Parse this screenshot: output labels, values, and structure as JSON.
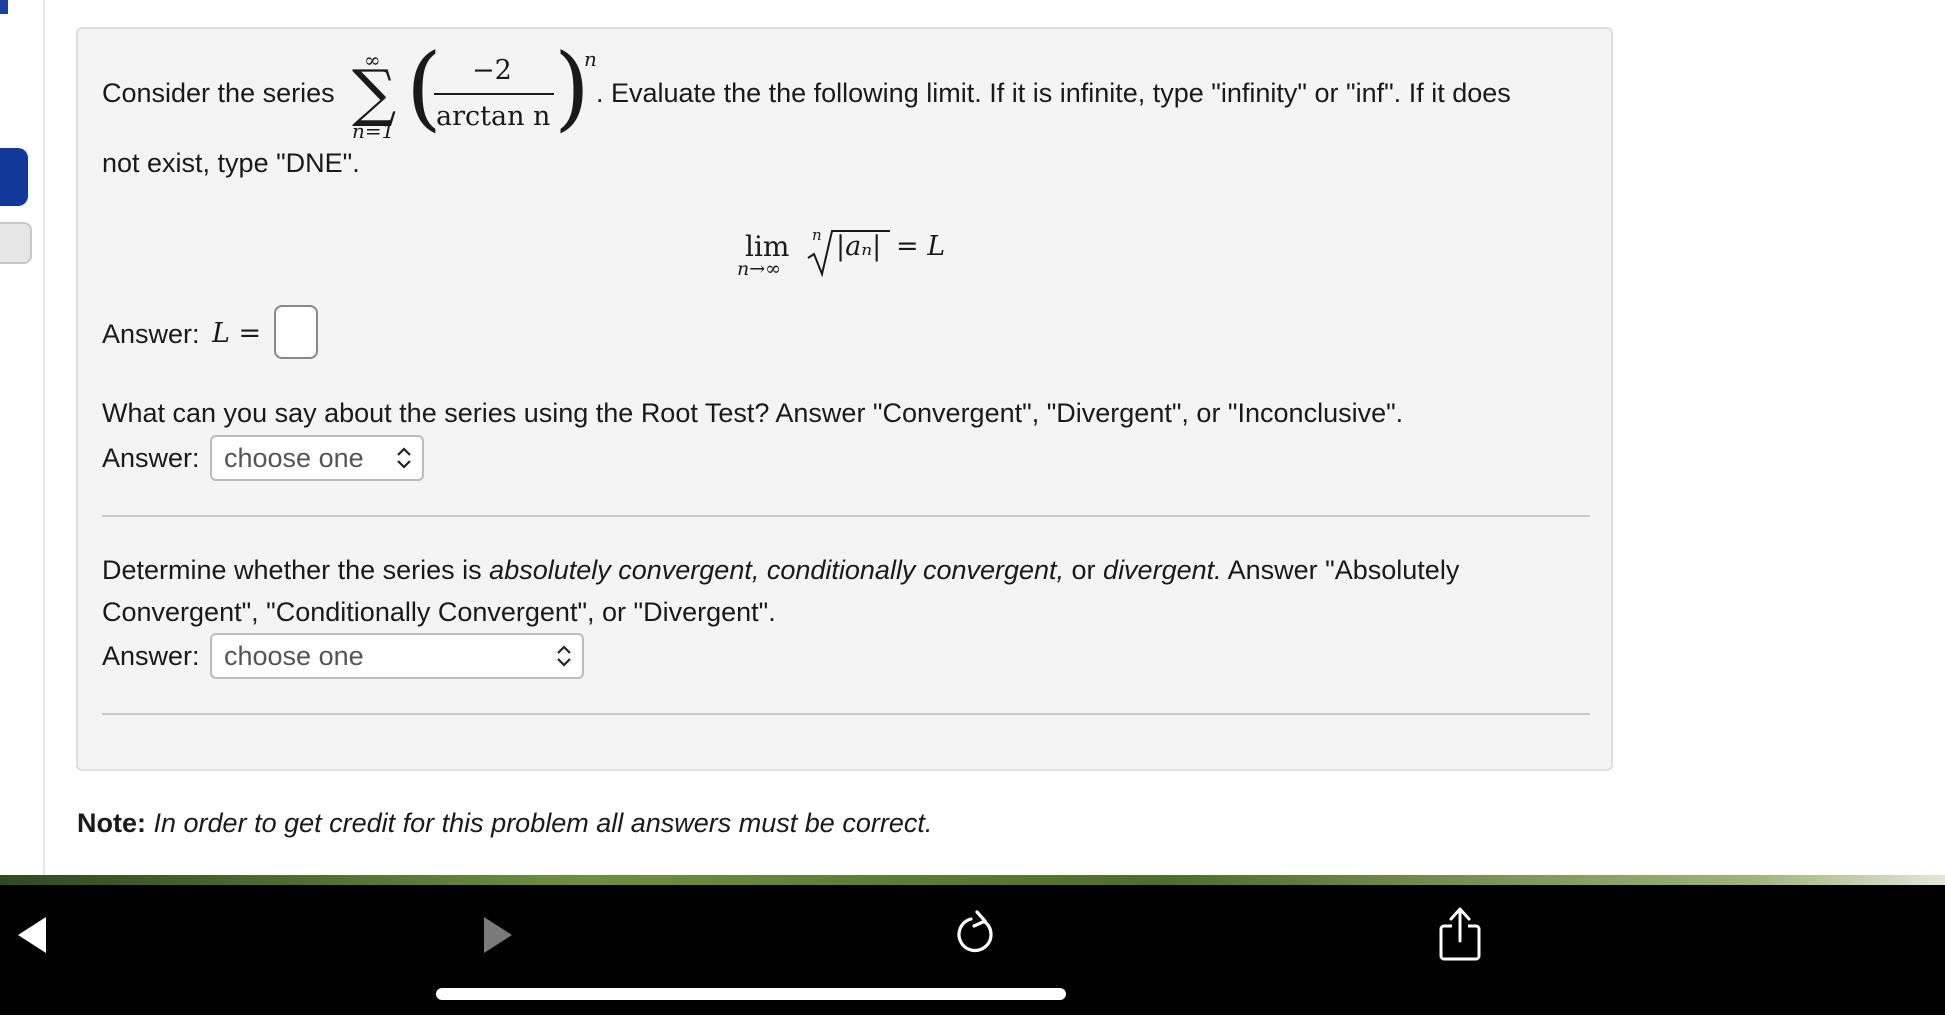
{
  "problem": {
    "intro_before": "Consider the series",
    "series": {
      "upper": "∞",
      "lower": "n=1",
      "numerator": "−2",
      "denominator": "arctan n",
      "exponent": "n"
    },
    "intro_after": ". Evaluate the the following limit. If it is infinite, type \"infinity\" or \"inf\". If it does",
    "intro_line2": "not exist, type \"DNE\".",
    "limit": {
      "lim": "lim",
      "sub": "n→∞",
      "root_index": "n",
      "radicand": "|aₙ|",
      "rhs": "= L"
    },
    "answer_label": "Answer:",
    "answer_var": "L =",
    "root_test_question": "What can you say about the series using the Root Test? Answer \"Convergent\", \"Divergent\", or \"Inconclusive\".",
    "root_test_select": "choose one",
    "determine": {
      "pre": "Determine whether the series is ",
      "italic1": "absolutely convergent, conditionally convergent,",
      "mid": " or ",
      "italic2": "divergent.",
      "post": " Answer \"Absolutely",
      "line2": "Convergent\", \"Conditionally Convergent\", or \"Divergent\"."
    },
    "determine_select": "choose one"
  },
  "note": {
    "label": "Note:",
    "text": "In order to get credit for this problem all answers must be correct."
  },
  "navbar": {
    "icons": [
      "back-icon",
      "forward-icon",
      "reload-icon",
      "share-icon"
    ]
  }
}
